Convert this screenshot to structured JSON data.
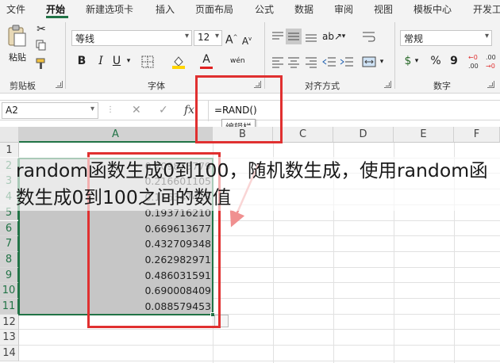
{
  "menu": {
    "tabs": [
      "文件",
      "开始",
      "新建选项卡",
      "插入",
      "页面布局",
      "公式",
      "数据",
      "审阅",
      "视图",
      "模板中心",
      "开发工"
    ],
    "active_tab": "开始"
  },
  "ribbon": {
    "clipboard": {
      "paste_label": "粘贴",
      "group_label": "剪贴板"
    },
    "font": {
      "font_name": "等线",
      "font_size": "12",
      "group_label": "字体",
      "bold": "B",
      "italic": "I",
      "underline": "U",
      "grow_font": "A",
      "shrink_font": "A",
      "phonetic": "wén"
    },
    "alignment": {
      "group_label": "对齐方式"
    },
    "number": {
      "format": "常规",
      "group_label": "数字",
      "currency": "$",
      "percent": "%",
      "comma": "9"
    }
  },
  "formula_bar": {
    "name_box": "A2",
    "cancel_icon": "✕",
    "enter_icon": "✓",
    "fx": "fx",
    "formula": "=RAND()",
    "tooltip": "编辑栏"
  },
  "sheet": {
    "columns": [
      "A",
      "B",
      "C",
      "D",
      "E",
      "F"
    ],
    "selected_column": "A",
    "rows": [
      "1",
      "2",
      "3",
      "4",
      "5",
      "6",
      "7",
      "8",
      "9",
      "10",
      "11",
      "12",
      "13",
      "14"
    ],
    "cells": {
      "A2": "0.209873779",
      "A3": "0.216601105",
      "A4": "0.116347418",
      "A5": "0.193716210",
      "A6": "0.669613677",
      "A7": "0.432709348",
      "A8": "0.262982971",
      "A9": "0.486031591",
      "A10": "0.690008409",
      "A11": "0.088579453"
    }
  },
  "caption": "random函数生成0到100，随机数生成，使用random函数生成0到100之间的数值",
  "colors": {
    "accent": "#217346",
    "annotation": "#e03030"
  }
}
